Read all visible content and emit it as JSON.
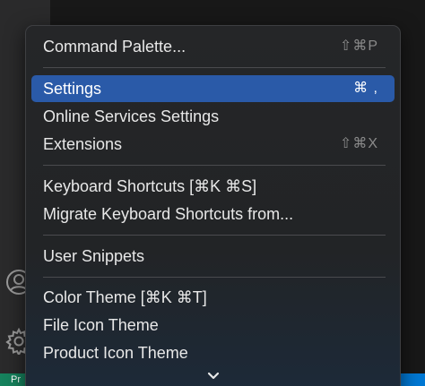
{
  "status_bar": {
    "remote_label": "Pr"
  },
  "menu": {
    "items": [
      {
        "label": "Command Palette...",
        "shortcut": "⇧⌘P"
      },
      {
        "label": "Settings",
        "shortcut": "⌘ ,",
        "active": true
      },
      {
        "label": "Online Services Settings",
        "shortcut": ""
      },
      {
        "label": "Extensions",
        "shortcut": "⇧⌘X"
      },
      {
        "label": "Keyboard Shortcuts [⌘K ⌘S]",
        "shortcut": ""
      },
      {
        "label": "Migrate Keyboard Shortcuts from...",
        "shortcut": ""
      },
      {
        "label": "User Snippets",
        "shortcut": ""
      },
      {
        "label": "Color Theme [⌘K ⌘T]",
        "shortcut": ""
      },
      {
        "label": "File Icon Theme",
        "shortcut": ""
      },
      {
        "label": "Product Icon Theme",
        "shortcut": ""
      }
    ]
  },
  "icons": {
    "account": "account-icon",
    "manage": "gear-icon",
    "scroll_more": "chevron-down-icon"
  },
  "colors": {
    "highlight": "#2a5aa8",
    "status_bar": "#0078d4",
    "remote_indicator": "#16825d"
  }
}
